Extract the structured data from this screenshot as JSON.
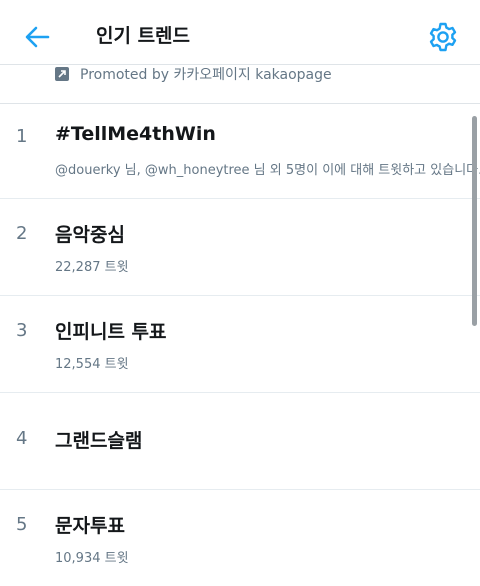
{
  "header": {
    "title": "인기 트렌드",
    "back_icon": "arrow-left-icon",
    "settings_icon": "gear-icon",
    "accent_color": "#1da1f2"
  },
  "promoted": {
    "icon": "promoted-icon",
    "text": "Promoted by 카카오페이지 kakaopage"
  },
  "trends": [
    {
      "rank": "1",
      "name": "#TellMe4thWin",
      "sub": "@douerky 님, @wh_honeytree 님 외 5명이 이에 대해 트윗하고 있습니다."
    },
    {
      "rank": "2",
      "name": "음악중심",
      "sub": "22,287 트윗"
    },
    {
      "rank": "3",
      "name": "인피니트 투표",
      "sub": "12,554 트윗"
    },
    {
      "rank": "4",
      "name": "그랜드슬램",
      "sub": ""
    },
    {
      "rank": "5",
      "name": "문자투표",
      "sub": "10,934 트윗"
    }
  ]
}
